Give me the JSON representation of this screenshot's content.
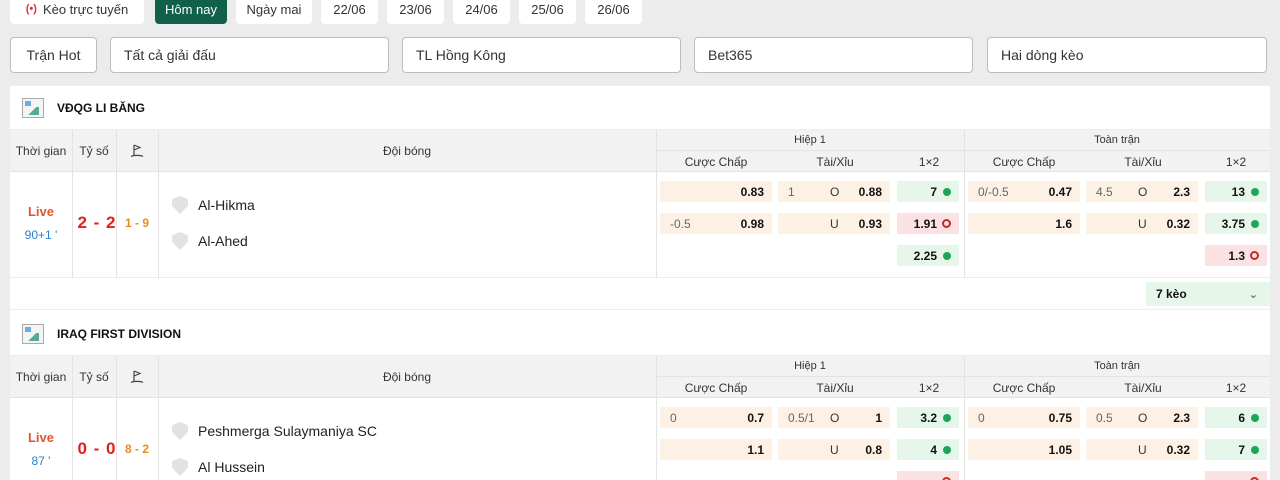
{
  "tabs": [
    "Kèo trực tuyến",
    "Hôm nay",
    "Ngày mai",
    "22/06",
    "23/06",
    "24/06",
    "25/06",
    "26/06"
  ],
  "live_icon": "(•)",
  "filters": {
    "hot": "Trận Hot",
    "league": "Tất cả giải đấu",
    "odds_type": "TL Hồng Kông",
    "bookmaker": "Bet365",
    "lines": "Hai dòng kèo"
  },
  "headers": {
    "time": "Thời gian",
    "score": "Tỷ số",
    "corner_icon": "corner-flag-icon",
    "teams": "Đội bóng",
    "first_half": "Hiệp 1",
    "full_time": "Toàn trận",
    "handicap": "Cược Chấp",
    "over_under": "Tài/Xỉu",
    "x12": "1×2"
  },
  "leagues": [
    {
      "name": "VĐQG LI BĂNG",
      "match": {
        "status": "Live",
        "minute": "90+1 '",
        "score": "2 - 2",
        "half_score": "1 - 9",
        "home": "Al-Hikma",
        "away": "Al-Ahed",
        "h1_handicap": [
          {
            "line": "",
            "val": "0.83"
          },
          {
            "line": "-0.5",
            "val": "0.98"
          }
        ],
        "h1_ou": [
          {
            "line": "1",
            "side": "O",
            "val": "0.88"
          },
          {
            "line": "",
            "side": "U",
            "val": "0.93"
          }
        ],
        "h1_x12": [
          {
            "val": "7",
            "trend": "up"
          },
          {
            "val": "1.91",
            "trend": "down"
          },
          {
            "val": "2.25",
            "trend": "up"
          }
        ],
        "ft_handicap": [
          {
            "line": "0/-0.5",
            "val": "0.47"
          },
          {
            "line": "",
            "val": "1.6"
          }
        ],
        "ft_ou": [
          {
            "line": "4.5",
            "side": "O",
            "val": "2.3"
          },
          {
            "line": "",
            "side": "U",
            "val": "0.32"
          }
        ],
        "ft_x12": [
          {
            "val": "13",
            "trend": "up"
          },
          {
            "val": "3.75",
            "trend": "up"
          },
          {
            "val": "1.3",
            "trend": "down"
          }
        ]
      },
      "more": "7 kèo"
    },
    {
      "name": "IRAQ FIRST DIVISION",
      "match": {
        "status": "Live",
        "minute": "87 '",
        "score": "0 - 0",
        "half_score": "8 - 2",
        "home": "Peshmerga Sulaymaniya SC",
        "away": "Al Hussein",
        "h1_handicap": [
          {
            "line": "0",
            "val": "0.7"
          },
          {
            "line": "",
            "val": "1.1"
          }
        ],
        "h1_ou": [
          {
            "line": "0.5/1",
            "side": "O",
            "val": "1"
          },
          {
            "line": "",
            "side": "U",
            "val": "0.8"
          }
        ],
        "h1_x12": [
          {
            "val": "3.2",
            "trend": "up"
          },
          {
            "val": "4",
            "trend": "up"
          },
          {
            "val": "",
            "trend": "down"
          }
        ],
        "ft_handicap": [
          {
            "line": "0",
            "val": "0.75"
          },
          {
            "line": "",
            "val": "1.05"
          }
        ],
        "ft_ou": [
          {
            "line": "0.5",
            "side": "O",
            "val": "2.3"
          },
          {
            "line": "",
            "side": "U",
            "val": "0.32"
          }
        ],
        "ft_x12": [
          {
            "val": "6",
            "trend": "up"
          },
          {
            "val": "7",
            "trend": "up"
          },
          {
            "val": "",
            "trend": "down"
          }
        ]
      },
      "more": ""
    }
  ]
}
